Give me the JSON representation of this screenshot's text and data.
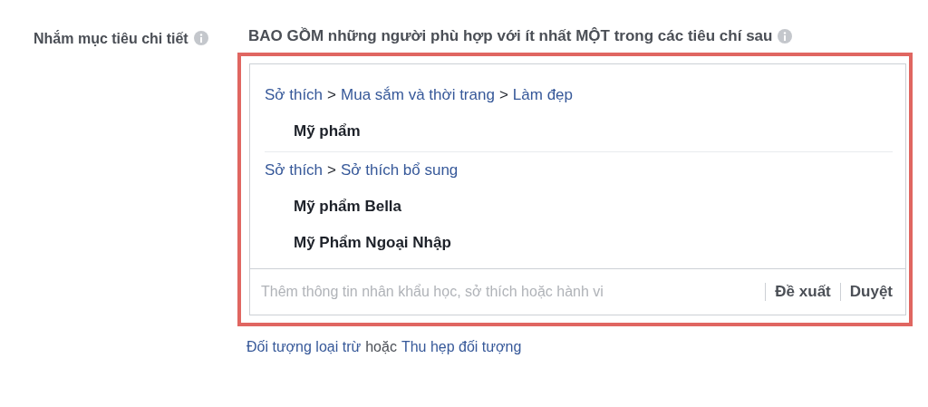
{
  "label": "Nhắm mục tiêu chi tiết",
  "heading": "BAO GỒM những người phù hợp với ít nhất MỘT trong các tiêu chí sau",
  "separator": ">",
  "groups": [
    {
      "path": [
        "Sở thích",
        "Mua sắm và thời trang",
        "Làm đẹp"
      ],
      "items": [
        "Mỹ phẩm"
      ]
    },
    {
      "path": [
        "Sở thích",
        "Sở thích bổ sung"
      ],
      "items": [
        "Mỹ phẩm Bella",
        "Mỹ Phẩm Ngoại Nhập"
      ]
    }
  ],
  "search": {
    "placeholder": "Thêm thông tin nhân khẩu học, sở thích hoặc hành vi"
  },
  "actions": [
    "Đề xuất",
    "Duyệt"
  ],
  "footer": {
    "link_1": "Đối tượng loại trừ",
    "joiner": "hoặc",
    "link_2": "Thu hẹp đối tượng"
  }
}
